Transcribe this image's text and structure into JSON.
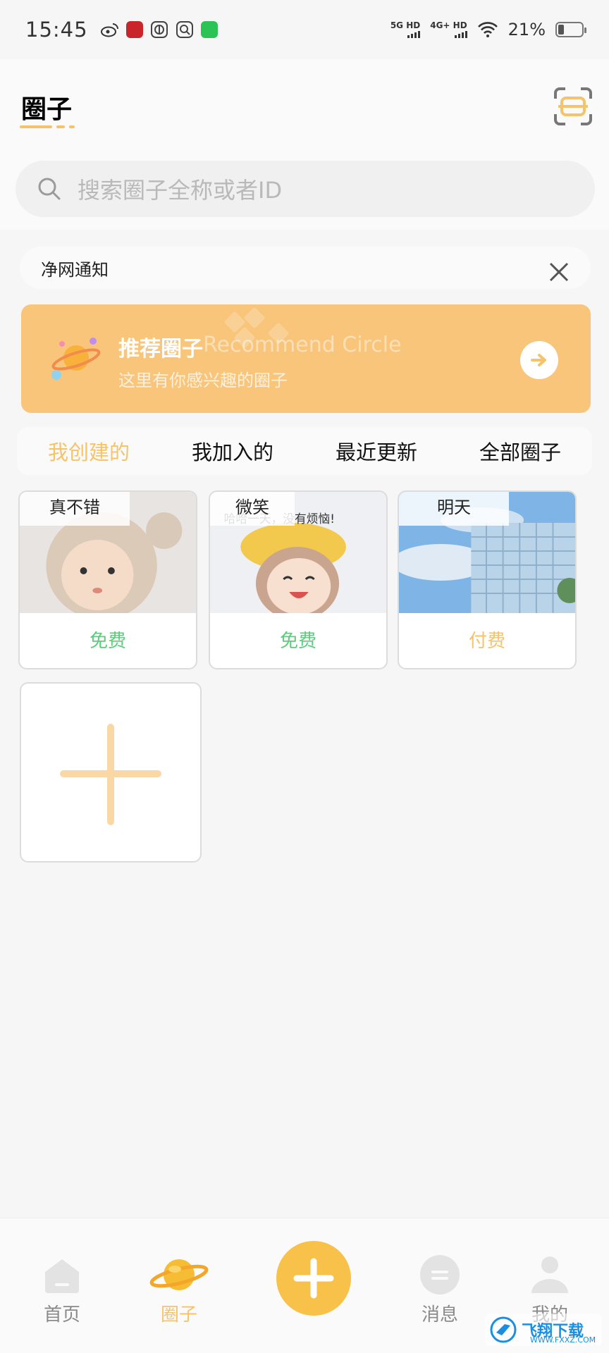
{
  "status_bar": {
    "time": "15:45",
    "network1_label": "5G HD",
    "network2_label": "4G+ HD",
    "battery": "21%"
  },
  "header": {
    "title": "圈子",
    "search_placeholder": "搜索圈子全称或者ID"
  },
  "notice": {
    "text": "净网通知"
  },
  "banner": {
    "title": "推荐圈子",
    "title_en": "Recommend Circle",
    "subtitle": "这里有你感兴趣的圈子"
  },
  "tabs": [
    {
      "label": "我创建的",
      "active": true
    },
    {
      "label": "我加入的",
      "active": false
    },
    {
      "label": "最近更新",
      "active": false
    },
    {
      "label": "全部圈子",
      "active": false
    }
  ],
  "circles": [
    {
      "name": "真不错",
      "price": "免费"
    },
    {
      "name": "微笑",
      "price": "免费"
    },
    {
      "name": "明天",
      "price": "付费"
    }
  ],
  "card_art_text": "哈哈一天，没有烦恼!",
  "bottom_nav": [
    {
      "label": "首页",
      "active": false
    },
    {
      "label": "圈子",
      "active": true
    },
    {
      "label": "消息",
      "active": false
    },
    {
      "label": "我的",
      "active": false
    }
  ],
  "watermark": {
    "text": "飞翔下载",
    "sub": "WWW.FXXZ.COM"
  },
  "colors": {
    "accent": "#f5c36b",
    "banner": "#f8c57a",
    "free": "#5bcd7b",
    "fab": "#f8c24a"
  }
}
